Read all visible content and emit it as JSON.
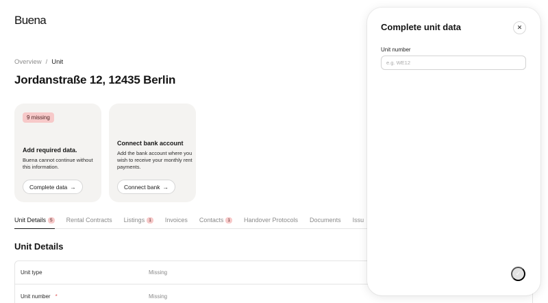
{
  "app": {
    "logo": "Buena"
  },
  "breadcrumb": {
    "items": [
      "Overview",
      "Unit"
    ],
    "separator": "/"
  },
  "page": {
    "title": "Jordanstraße 12, 12435 Berlin"
  },
  "cards": [
    {
      "badge": "9 missing",
      "title": "Add required data.",
      "description": "Buena cannot continue without this information.",
      "button_label": "Complete data",
      "button_icon": "arrow-right-icon"
    },
    {
      "title": "Connect bank account",
      "description": "Add the bank account where you wish to receive your monthly rent payments.",
      "button_label": "Connect bank",
      "button_icon": "arrow-right-icon"
    }
  ],
  "tabs": [
    {
      "label": "Unit Details",
      "count": "5",
      "active": true
    },
    {
      "label": "Rental Contracts"
    },
    {
      "label": "Listings",
      "count": "1"
    },
    {
      "label": "Invoices"
    },
    {
      "label": "Contacts",
      "count": "1"
    },
    {
      "label": "Handover Protocols"
    },
    {
      "label": "Documents"
    },
    {
      "label": "Issu"
    }
  ],
  "section": {
    "title": "Unit Details",
    "rows": [
      {
        "label": "Unit type",
        "value": "Missing"
      },
      {
        "label": "Unit number",
        "value": "Missing",
        "required_marker": "*"
      }
    ]
  },
  "modal": {
    "title": "Complete unit data",
    "close_icon": "close-icon",
    "field": {
      "label": "Unit number",
      "placeholder": "e.g. WE12",
      "value": ""
    },
    "submit_icon": "check-icon"
  },
  "colors": {
    "missing_badge_bg": "#f7c9c9",
    "card_bg": "#f4f3f1",
    "required": "#e05656"
  }
}
